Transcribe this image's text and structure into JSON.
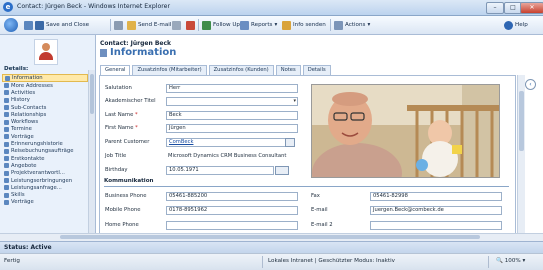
{
  "window": {
    "title": "Contact: Jürgen Beck - Windows Internet Explorer"
  },
  "toolbar": {
    "save_close": "Save and Close",
    "send_email": "Send E-mail",
    "follow_up": "Follow Up",
    "reports": "Reports",
    "info_senden": "Info senden",
    "actions": "Actions",
    "help": "Help"
  },
  "sidebar": {
    "details_label": "Details:",
    "items": [
      {
        "label": "Information",
        "selected": true
      },
      {
        "label": "More Addresses"
      },
      {
        "label": "Activities"
      },
      {
        "label": "History"
      },
      {
        "label": "Sub-Contacts"
      },
      {
        "label": "Relationships"
      },
      {
        "label": "Workflows"
      },
      {
        "label": "Termine"
      },
      {
        "label": "Verträge"
      },
      {
        "label": "Erinnerungshistorie"
      },
      {
        "label": "Reisebuchungsaufträge"
      },
      {
        "label": "Erstkontakte"
      },
      {
        "label": "Angebote"
      },
      {
        "label": "Projektverantwortl..."
      },
      {
        "label": "Leistungserbringungen"
      },
      {
        "label": "Leistungsanfrage..."
      },
      {
        "label": "Skills"
      },
      {
        "label": "Verträge"
      }
    ]
  },
  "header": {
    "contact_line": "Contact: Jürgen Beck",
    "title": "Information"
  },
  "tabs": [
    {
      "label": "General",
      "active": true
    },
    {
      "label": "Zusatzinfos (Mitarbeiter)"
    },
    {
      "label": "Zusatzinfos (Kunden)"
    },
    {
      "label": "Notes"
    },
    {
      "label": "Details"
    }
  ],
  "form": {
    "salutation": {
      "label": "Salutation",
      "value": "Herr"
    },
    "akademischer_titel": {
      "label": "Akademischer Titel",
      "value": ""
    },
    "last_name": {
      "label": "Last Name",
      "value": "Beck"
    },
    "first_name": {
      "label": "First Name",
      "value": "Jürgen"
    },
    "parent_customer": {
      "label": "Parent Customer",
      "value": "ComBeck"
    },
    "job_title": {
      "label": "Job Title",
      "value": "Microsoft Dynamics CRM Business Consultant"
    },
    "birthday": {
      "label": "Birthday",
      "value": "10.05.1971"
    },
    "section_kommunikation": "Kommunikation",
    "business_phone": {
      "label": "Business Phone",
      "value": "05461-885200"
    },
    "fax": {
      "label": "Fax",
      "value": "05461-82998"
    },
    "mobile_phone": {
      "label": "Mobile Phone",
      "value": "0178-8951962"
    },
    "email": {
      "label": "E-mail",
      "value": "Juergen.Beck@combeck.de"
    },
    "home_phone": {
      "label": "Home Phone",
      "value": ""
    },
    "email2": {
      "label": "E-mail 2",
      "value": ""
    }
  },
  "status": {
    "label": "Status: Active"
  },
  "ie_status": {
    "left": "Fertig",
    "zone": "Lokales Intranet | Geschützter Modus: Inaktiv",
    "zoom": "100%"
  },
  "colors": {
    "accent": "#3a6fb0",
    "selected": "#ffe9a8",
    "chrome": "#dbe6f4"
  }
}
